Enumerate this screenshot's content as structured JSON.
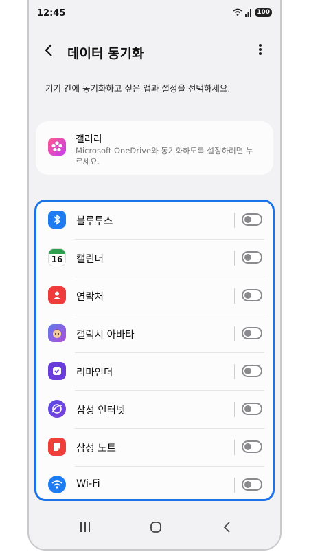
{
  "status_bar": {
    "time": "12:45",
    "battery": "100"
  },
  "header": {
    "title": "데이터 동기화"
  },
  "description": "기기 간에 동기화하고 싶은 앱과 설정을 선택하세요.",
  "gallery": {
    "name": "갤러리",
    "subtitle": "Microsoft OneDrive와 동기화하도록 설정하려면 누르세요."
  },
  "calendar_icon_day": "16",
  "sync_items": [
    {
      "label": "블루투스",
      "icon": "bluetooth-icon",
      "enabled": false
    },
    {
      "label": "캘린더",
      "icon": "calendar-icon",
      "enabled": false
    },
    {
      "label": "연락처",
      "icon": "contacts-icon",
      "enabled": false
    },
    {
      "label": "갤럭시 아바타",
      "icon": "avatar-icon",
      "enabled": false
    },
    {
      "label": "리마인더",
      "icon": "reminder-icon",
      "enabled": false
    },
    {
      "label": "삼성 인터넷",
      "icon": "samsung-internet-icon",
      "enabled": false
    },
    {
      "label": "삼성 노트",
      "icon": "samsung-notes-icon",
      "enabled": false
    },
    {
      "label": "Wi-Fi",
      "icon": "wifi-icon",
      "enabled": false
    }
  ],
  "colors": {
    "highlight_border": "#1a73e8"
  }
}
